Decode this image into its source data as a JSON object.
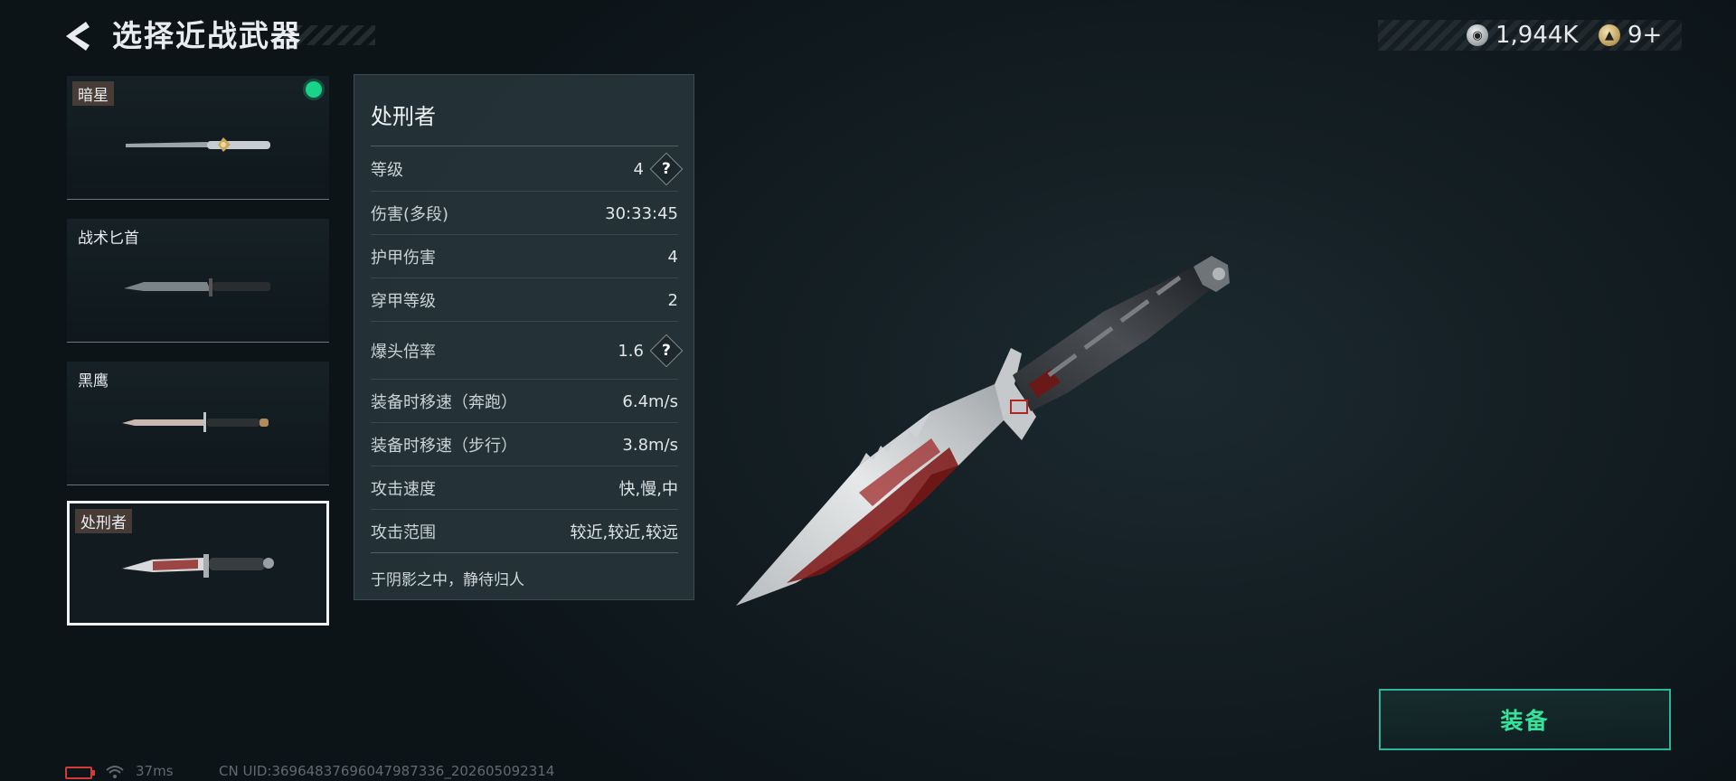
{
  "header": {
    "title": "选择近战武器",
    "currencies": [
      {
        "icon": "silver-coin-icon",
        "value": "1,944K"
      },
      {
        "icon": "gold-medal-icon",
        "value": "9+"
      }
    ]
  },
  "weapons": [
    {
      "name": "暗星",
      "equipped": true,
      "selected": false
    },
    {
      "name": "战术匕首",
      "equipped": false,
      "selected": false
    },
    {
      "name": "黑鹰",
      "equipped": false,
      "selected": false
    },
    {
      "name": "处刑者",
      "equipped": false,
      "selected": true
    }
  ],
  "details": {
    "name": "处刑者",
    "stats": [
      {
        "label": "等级",
        "value": "4",
        "help": true
      },
      {
        "label": "伤害(多段)",
        "value": "30:33:45",
        "help": false
      },
      {
        "label": "护甲伤害",
        "value": "4",
        "help": false
      },
      {
        "label": "穿甲等级",
        "value": "2",
        "help": false
      },
      {
        "label": "爆头倍率",
        "value": "1.6",
        "help": true
      },
      {
        "label": "装备时移速（奔跑）",
        "value": "6.4m/s",
        "help": false
      },
      {
        "label": "装备时移速（步行）",
        "value": "3.8m/s",
        "help": false
      },
      {
        "label": "攻击速度",
        "value": "快,慢,中",
        "help": false
      },
      {
        "label": "攻击范围",
        "value": "较近,较近,较远",
        "help": false
      }
    ],
    "help_symbol": "?",
    "flavor": "于阴影之中，静待归人"
  },
  "actions": {
    "equip_label": "装备"
  },
  "footer": {
    "ping": "37ms",
    "uid": "CN UID:3696483769604798733​6_202605092314"
  },
  "colors": {
    "accent_green": "#36e39c",
    "equip_border": "#2bb59b",
    "battery_low": "#d23a3a"
  }
}
